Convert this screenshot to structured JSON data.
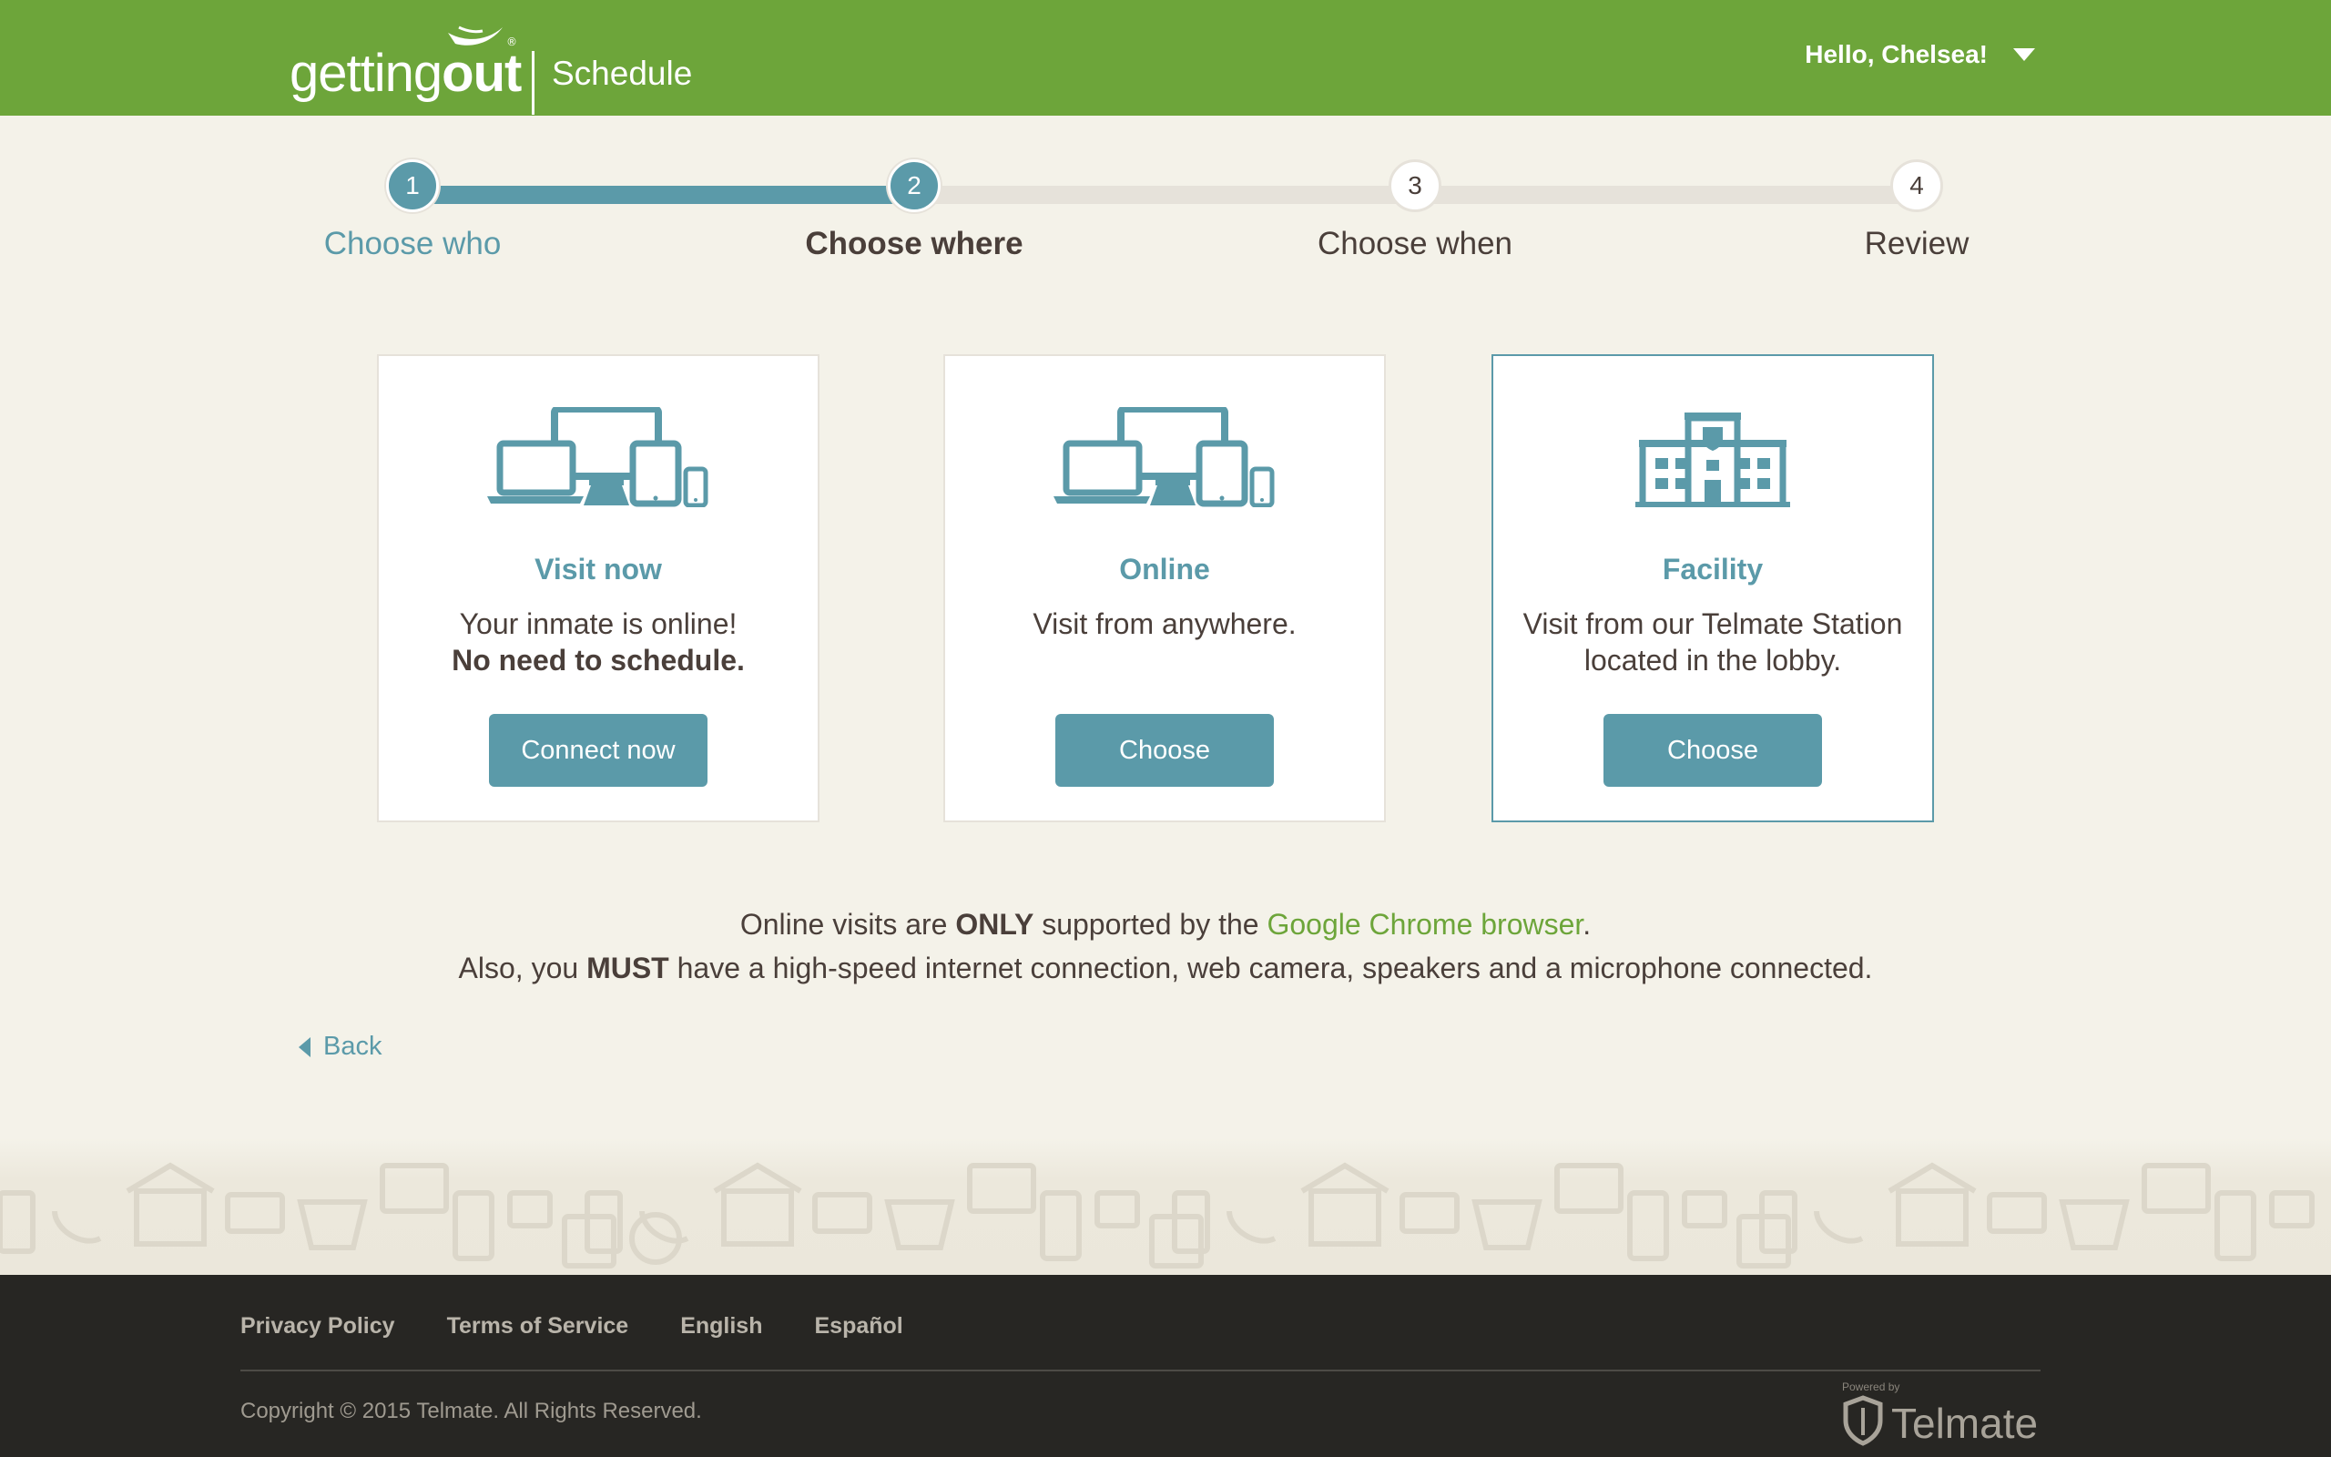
{
  "header": {
    "logo_text_light": "getting",
    "logo_text_bold": "out",
    "logo_registered": "®",
    "product": "Schedule",
    "greeting": "Hello, Chelsea!"
  },
  "stepper": {
    "steps": [
      {
        "number": "1",
        "label": "Choose who",
        "state": "done"
      },
      {
        "number": "2",
        "label": "Choose where",
        "state": "current"
      },
      {
        "number": "3",
        "label": "Choose when",
        "state": "todo"
      },
      {
        "number": "4",
        "label": "Review",
        "state": "todo"
      }
    ]
  },
  "cards": [
    {
      "icon": "devices-icon",
      "title": "Visit now",
      "desc_line1": "Your inmate is online!",
      "desc_bold": "No need to schedule.",
      "button": "Connect now",
      "selected": false
    },
    {
      "icon": "devices-icon",
      "title": "Online",
      "desc_line1": "Visit from anywhere.",
      "desc_bold": "",
      "button": "Choose",
      "selected": false
    },
    {
      "icon": "building-icon",
      "title": "Facility",
      "desc_line1": "Visit from our Telmate Station located in the lobby.",
      "desc_bold": "",
      "button": "Choose",
      "selected": true
    }
  ],
  "notice": {
    "line1_pre": "Online visits are ",
    "line1_bold": "ONLY",
    "line1_mid": " supported by the ",
    "line1_link": "Google Chrome browser",
    "line1_end": ".",
    "line2_pre": "Also, you ",
    "line2_bold": "MUST",
    "line2_end": " have a high-speed internet connection, web camera, speakers and a microphone connected."
  },
  "back": "Back",
  "footer": {
    "links": [
      "Privacy Policy",
      "Terms of Service",
      "English",
      "Español"
    ],
    "copyright": "Copyright © 2015 Telmate. All Rights Reserved.",
    "powered_by": "Powered by",
    "brand": "Telmate"
  },
  "colors": {
    "brand_green": "#6da53a",
    "accent_teal": "#5b9aa9",
    "background": "#f4f2e9",
    "footer": "#272623"
  }
}
